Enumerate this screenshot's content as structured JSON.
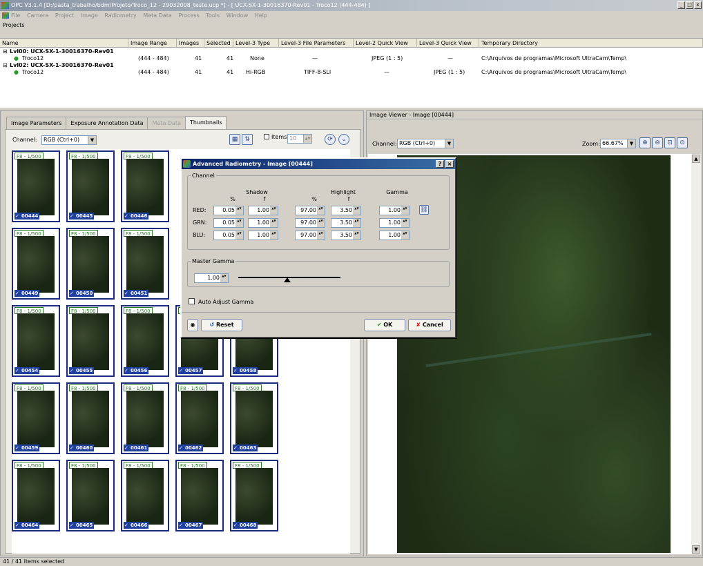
{
  "window": {
    "title": "OPC V3.1.4  [D:/pasta_trabalho/bdm/Projeto/Troco_12 - 29032008_teste.ucp *]  - [ UCX-SX-1-30016370-Rev01 - Troco12 (444-484) ]",
    "controls": [
      "_",
      "□",
      "x"
    ]
  },
  "menubar": {
    "items": [
      "File",
      "Camera",
      "Project",
      "Image",
      "Radiometry",
      "Meta Data",
      "Process",
      "Tools",
      "Window",
      "Help"
    ]
  },
  "projects_panel": {
    "title": "Projects",
    "columns": [
      "Name",
      "Image Range",
      "Images",
      "Selected",
      "Level-3 Type",
      "Level-3 File Parameters",
      "Level-2 Quick View",
      "Level-3 Quick View",
      "Temporary Directory"
    ],
    "rows": [
      {
        "name": "Lvl00: UCX-SX-1-30016370-Rev01",
        "bold": true,
        "cells": [
          "",
          "",
          "",
          "",
          "",
          "",
          "",
          ""
        ]
      },
      {
        "name": "Troco12",
        "bold": false,
        "cells": [
          "(444 - 484)",
          "41",
          "41",
          "None",
          "—",
          "JPEG (1 : 5)",
          "—",
          "C:\\Arquivos de programas\\Microsoft UltraCam\\Temp\\"
        ]
      },
      {
        "name": "Lvl02: UCX-SX-1-30016370-Rev01",
        "bold": true,
        "cells": [
          "",
          "",
          "",
          "",
          "",
          "",
          "",
          ""
        ]
      },
      {
        "name": "Troco12",
        "bold": false,
        "cells": [
          "(444 - 484)",
          "41",
          "41",
          "Hi-RGB",
          "TIFF-8-SLI",
          "—",
          "JPEG (1 : 5)",
          "C:\\Arquivos de programas\\Microsoft UltraCam\\Temp\\"
        ]
      }
    ]
  },
  "left_panel": {
    "tabs": [
      "Image Parameters",
      "Exposure Annotation Data",
      "Meta Data",
      "Thumbnails"
    ],
    "channel_label": "Channel:",
    "channel_value": "RGB   (Ctrl+0)",
    "items_label": "Items",
    "items_value": "10",
    "thumb_caption": "F8 - 1/500",
    "thumbnails": [
      [
        "00444",
        "00445",
        "00446",
        "",
        ""
      ],
      [
        "00449",
        "00450",
        "00451",
        "",
        ""
      ],
      [
        "00454",
        "00455",
        "00456",
        "00457",
        "00458"
      ],
      [
        "00459",
        "00460",
        "00461",
        "00462",
        "00463"
      ],
      [
        "00464",
        "00465",
        "00466",
        "00467",
        "00468"
      ]
    ]
  },
  "viewer": {
    "title": "Image Viewer - Image [00444]",
    "channel_label": "Channel:",
    "channel_value": "RGB   (Ctrl+0)",
    "zoom_label": "Zoom:",
    "zoom_value": "66.67%"
  },
  "dialog": {
    "title": "Advanced Radiometry - Image [00444]",
    "channel_group": "Channel",
    "shadow_label": "Shadow",
    "highlight_label": "Highlight",
    "gamma_label": "Gamma",
    "pct_label": "%",
    "f_label": "f",
    "rows": [
      {
        "label": "RED:",
        "shadow_pct": "0.05",
        "shadow_f": "1.00",
        "hl_pct": "97.00",
        "hl_f": "3.50",
        "gamma": "1.00"
      },
      {
        "label": "GRN:",
        "shadow_pct": "0.05",
        "shadow_f": "1.00",
        "hl_pct": "97.00",
        "hl_f": "3.50",
        "gamma": "1.00"
      },
      {
        "label": "BLU:",
        "shadow_pct": "0.05",
        "shadow_f": "1.00",
        "hl_pct": "97.00",
        "hl_f": "3.50",
        "gamma": "1.00"
      }
    ],
    "master_gamma_group": "Master Gamma",
    "master_gamma_value": "1.00",
    "auto_adjust_label": "Auto Adjust Gamma",
    "reset_label": "Reset",
    "ok_label": "OK",
    "cancel_label": "Cancel"
  },
  "status": {
    "text": "41 / 41 items selected"
  }
}
